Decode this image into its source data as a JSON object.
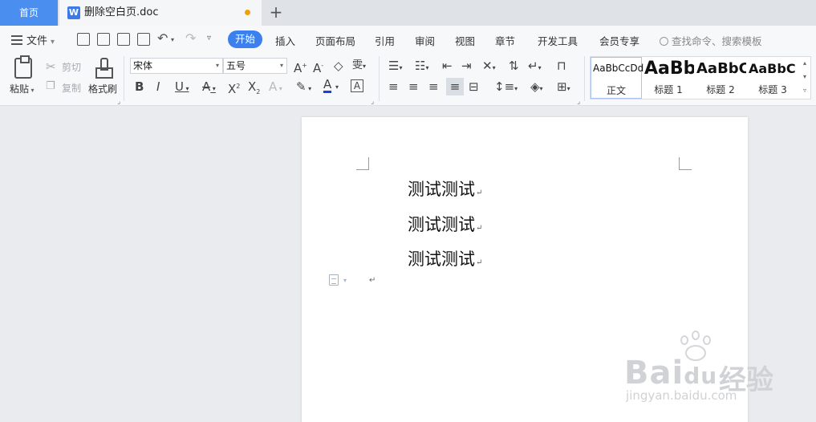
{
  "tabs": {
    "home": "首页",
    "document": "删除空白页.doc",
    "add": "+"
  },
  "menu": {
    "file": "文件",
    "tabs": [
      "开始",
      "插入",
      "页面布局",
      "引用",
      "审阅",
      "视图",
      "章节",
      "开发工具",
      "会员专享"
    ],
    "search": "查找命令、搜索模板"
  },
  "ribbon": {
    "paste": "粘贴",
    "cut": "剪切",
    "copy": "复制",
    "format_painter": "格式刷",
    "font_name": "宋体",
    "font_size": "五号",
    "styles": [
      {
        "sample": "AaBbCcDd",
        "name": "正文"
      },
      {
        "sample": "AaBb",
        "name": "标题 1"
      },
      {
        "sample": "AaBbC",
        "name": "标题 2"
      },
      {
        "sample": "AaBbC",
        "name": "标题 3"
      }
    ]
  },
  "document": {
    "lines": [
      "测试测试",
      "测试测试",
      "测试测试"
    ],
    "para_mark": "↵"
  },
  "watermark": {
    "brand": "Bai",
    "brand2": "du",
    "cn": "经验",
    "url": "jingyan.baidu.com"
  },
  "colors": {
    "accent": "#3b80ee",
    "home_tab": "#4a8ff0",
    "font_color_bar": "#1a3fe0",
    "modified_dot": "#f0a100"
  }
}
